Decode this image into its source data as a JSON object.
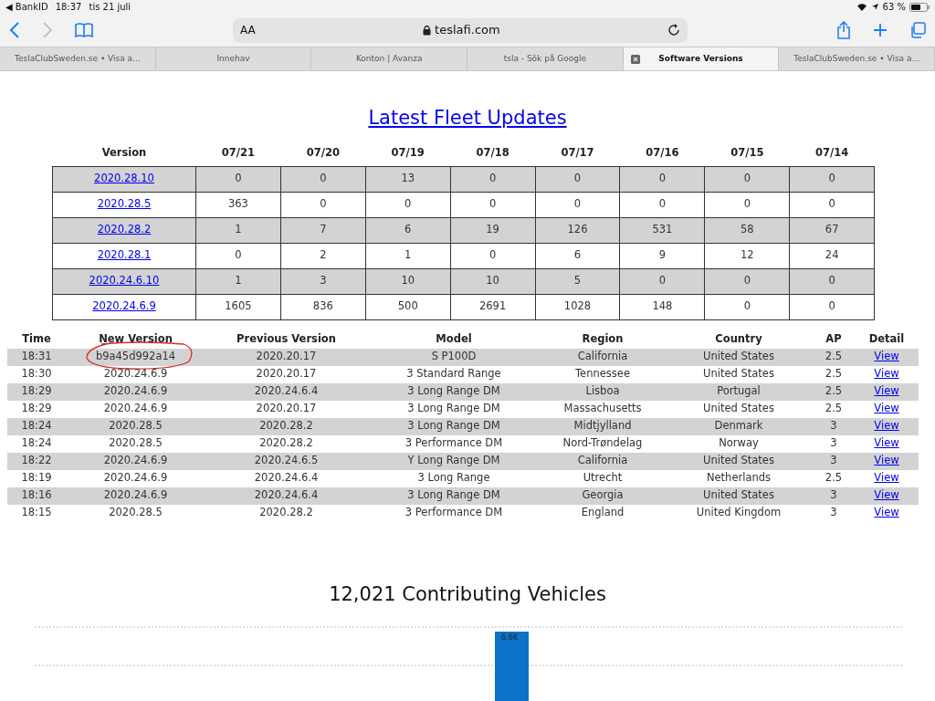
{
  "status_bar": {
    "back_app": "◀ BankID",
    "time": "18:37",
    "date": "tis 21 juli",
    "battery": "63 %"
  },
  "toolbar": {
    "back_enabled": true,
    "forward_enabled": false,
    "text_size": "AA",
    "address": "teslafi.com"
  },
  "tabs": [
    {
      "label": "TeslaClubSweden.se • Visa a...",
      "selected": false
    },
    {
      "label": "Innehav",
      "selected": false
    },
    {
      "label": "Konton | Avanza",
      "selected": false
    },
    {
      "label": "tsla - Sök på Google",
      "selected": false
    },
    {
      "label": "Software Versions",
      "selected": true
    },
    {
      "label": "TeslaClubSweden.se • Visa a...",
      "selected": false
    }
  ],
  "page_title": "Latest Fleet Updates",
  "fleet_table": {
    "columns": [
      "Version",
      "07/21",
      "07/20",
      "07/19",
      "07/18",
      "07/17",
      "07/16",
      "07/15",
      "07/14"
    ],
    "rows": [
      {
        "version": "2020.28.10",
        "counts": [
          "0",
          "0",
          "13",
          "0",
          "0",
          "0",
          "0",
          "0"
        ]
      },
      {
        "version": "2020.28.5",
        "counts": [
          "363",
          "0",
          "0",
          "0",
          "0",
          "0",
          "0",
          "0"
        ]
      },
      {
        "version": "2020.28.2",
        "counts": [
          "1",
          "7",
          "6",
          "19",
          "126",
          "531",
          "58",
          "67"
        ]
      },
      {
        "version": "2020.28.1",
        "counts": [
          "0",
          "2",
          "1",
          "0",
          "6",
          "9",
          "12",
          "24"
        ]
      },
      {
        "version": "2020.24.6.10",
        "counts": [
          "1",
          "3",
          "10",
          "10",
          "5",
          "0",
          "0",
          "0"
        ]
      },
      {
        "version": "2020.24.6.9",
        "counts": [
          "1605",
          "836",
          "500",
          "2691",
          "1028",
          "148",
          "0",
          "0"
        ]
      }
    ]
  },
  "updates_table": {
    "columns": [
      "Time",
      "New Version",
      "Previous Version",
      "Model",
      "Region",
      "Country",
      "AP",
      "Detail"
    ],
    "rows": [
      {
        "time": "18:31",
        "new_version": "b9a45d992a14",
        "previous_version": "2020.20.17",
        "model": "S P100D",
        "region": "California",
        "country": "United States",
        "ap": "2.5",
        "detail": "View",
        "circled": true
      },
      {
        "time": "18:30",
        "new_version": "2020.24.6.9",
        "previous_version": "2020.20.17",
        "model": "3 Standard Range",
        "region": "Tennessee",
        "country": "United States",
        "ap": "2.5",
        "detail": "View",
        "circled": false
      },
      {
        "time": "18:29",
        "new_version": "2020.24.6.9",
        "previous_version": "2020.24.6.4",
        "model": "3 Long Range DM",
        "region": "Lisboa",
        "country": "Portugal",
        "ap": "2.5",
        "detail": "View",
        "circled": false
      },
      {
        "time": "18:29",
        "new_version": "2020.24.6.9",
        "previous_version": "2020.20.17",
        "model": "3 Long Range DM",
        "region": "Massachusetts",
        "country": "United States",
        "ap": "2.5",
        "detail": "View",
        "circled": false
      },
      {
        "time": "18:24",
        "new_version": "2020.28.5",
        "previous_version": "2020.28.2",
        "model": "3 Long Range DM",
        "region": "Midtjylland",
        "country": "Denmark",
        "ap": "3",
        "detail": "View",
        "circled": false
      },
      {
        "time": "18:24",
        "new_version": "2020.28.5",
        "previous_version": "2020.28.2",
        "model": "3 Performance DM",
        "region": "Nord-Trøndelag",
        "country": "Norway",
        "ap": "3",
        "detail": "View",
        "circled": false
      },
      {
        "time": "18:22",
        "new_version": "2020.24.6.9",
        "previous_version": "2020.24.6.5",
        "model": "Y Long Range DM",
        "region": "California",
        "country": "United States",
        "ap": "3",
        "detail": "View",
        "circled": false
      },
      {
        "time": "18:19",
        "new_version": "2020.24.6.9",
        "previous_version": "2020.24.6.4",
        "model": "3 Long Range",
        "region": "Utrecht",
        "country": "Netherlands",
        "ap": "2.5",
        "detail": "View",
        "circled": false
      },
      {
        "time": "18:16",
        "new_version": "2020.24.6.9",
        "previous_version": "2020.24.6.4",
        "model": "3 Long Range DM",
        "region": "Georgia",
        "country": "United States",
        "ap": "3",
        "detail": "View",
        "circled": false
      },
      {
        "time": "18:15",
        "new_version": "2020.28.5",
        "previous_version": "2020.28.2",
        "model": "3 Performance DM",
        "region": "England",
        "country": "United Kingdom",
        "ap": "3",
        "detail": "View",
        "circled": false
      }
    ]
  },
  "chart": {
    "title": "12,021 Contributing Vehicles",
    "bar_label": "6.6K"
  }
}
